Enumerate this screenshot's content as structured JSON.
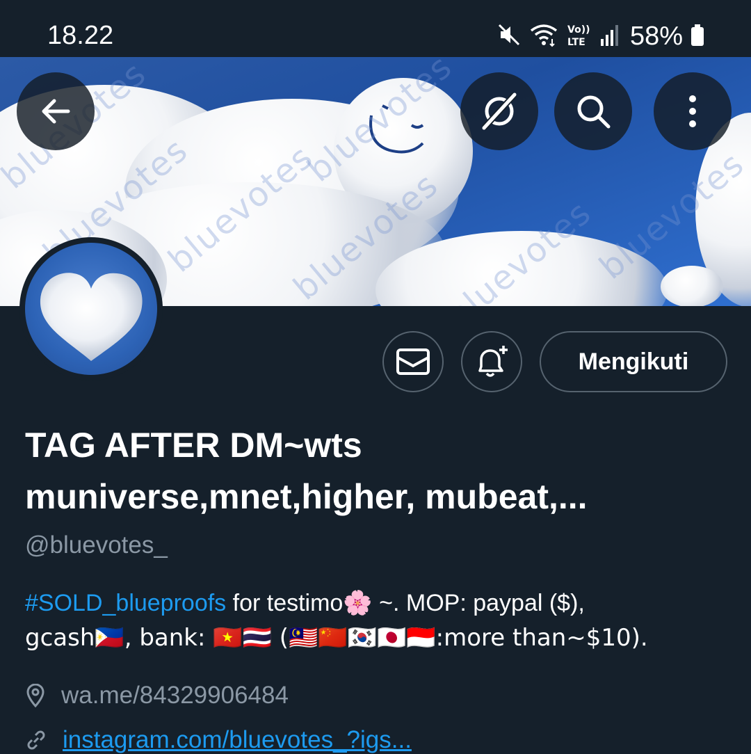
{
  "status_bar": {
    "time": "18.22",
    "lte_label": "LTE",
    "volte_label": "Vo))",
    "battery": "58%"
  },
  "banner": {
    "watermark": "bluevotes"
  },
  "profile": {
    "follow_label": "Mengikuti",
    "name_line1": "TAG AFTER DM~wts",
    "name_line2": "muniverse,mnet,higher, mubeat,...",
    "handle": "@bluevotes_",
    "bio": {
      "hashtag": "#SOLD_blueproofs",
      "line1_rest": " for testimo🌸 ~. MOP: paypal ($),",
      "line2": "gcash🇵🇭, bank: 🇻🇳🇹🇭 (🇲🇾🇨🇳🇰🇷🇯🇵🇮🇩:more than~$10)."
    },
    "location": "wa.me/84329906484",
    "website": "instagram.com/bluevotes_?igs..."
  },
  "colors": {
    "background": "#15202b",
    "link": "#1d9bf0",
    "muted": "#8b98a5",
    "border": "#56636f"
  }
}
